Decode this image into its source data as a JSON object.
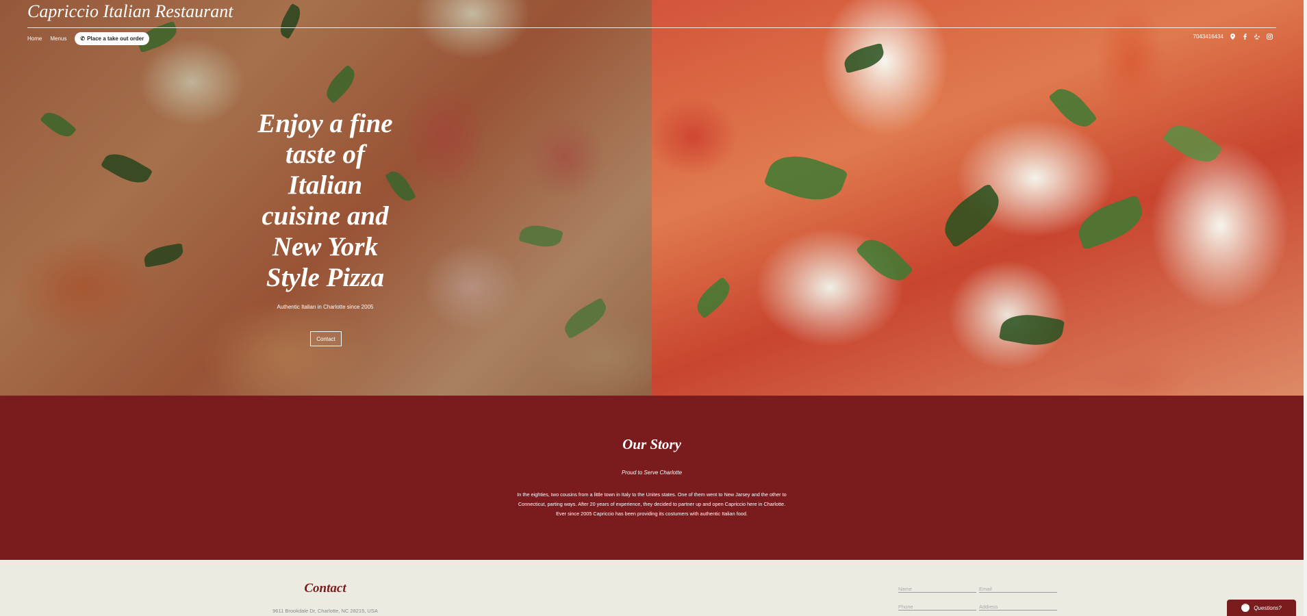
{
  "brand": "Capriccio Italian Restaurant",
  "nav": {
    "home": "Home",
    "menus": "Menus",
    "order_button": "Place a take out order",
    "phone": "7043416434"
  },
  "hero": {
    "title": "Enjoy a fine taste of Italian cuisine and New York Style Pizza",
    "subtitle": "Authentic Italian in Charlotte since 2005",
    "contact_button": "Contact"
  },
  "story": {
    "title": "Our Story",
    "subtitle": "Proud to Serve Charlotte",
    "body": "In the eighties, two cousins from a little town in Italy to the Unites states. One of them went to New Jarsey and the other to Connecticut, parting ways. After 20 years of experience, they decided to partner up and open Capriccio here in Charlotte. Ever since 2005 Capriccio has been providing its costumers with authentic Italian food."
  },
  "contact": {
    "title": "Contact",
    "address": "9611 Brookdale Dr, Charlotte, NC 28215, USA",
    "fields": {
      "name": "Name",
      "email": "Email",
      "phone": "Phone",
      "address": "Address"
    }
  },
  "chat": {
    "label": "Questions?"
  },
  "colors": {
    "accent": "#7a1b1e",
    "background": "#ecebe2"
  }
}
